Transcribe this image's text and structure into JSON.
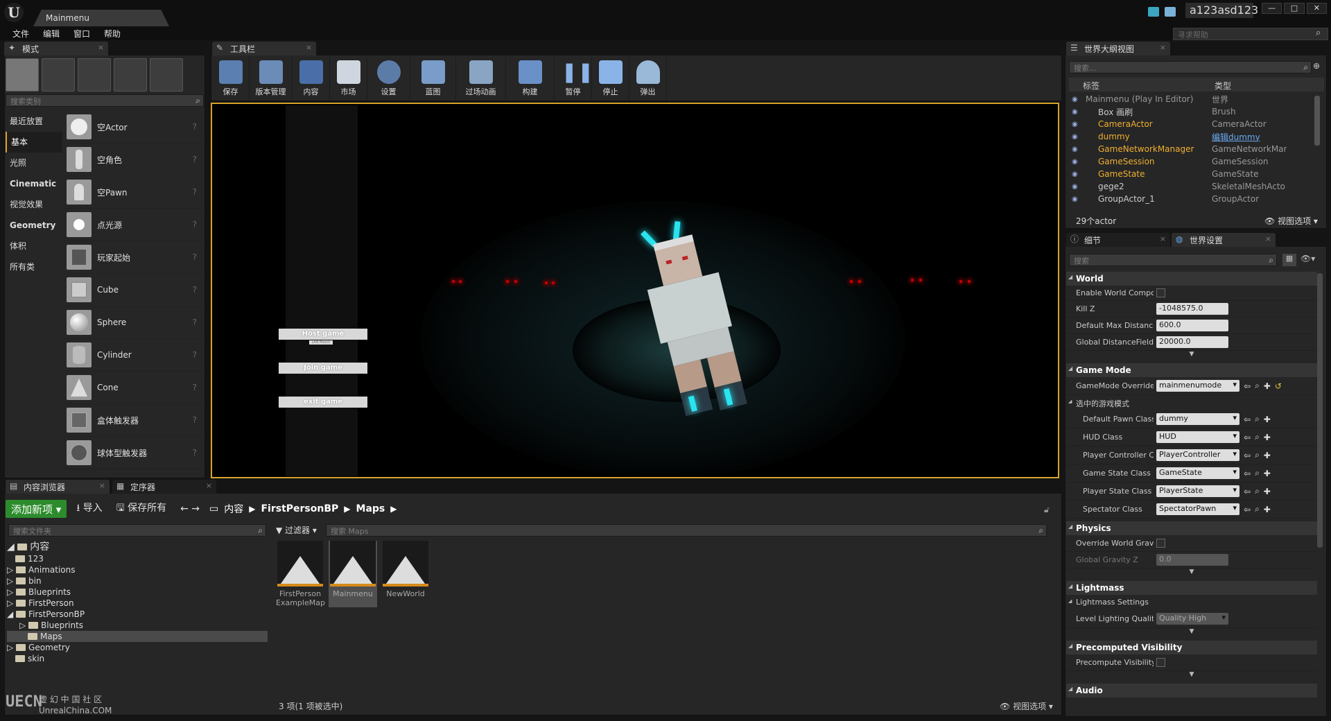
{
  "window": {
    "doc_tab": "Mainmenu",
    "user": "a123asd123",
    "minimize": "—",
    "maximize": "□",
    "close": "✕"
  },
  "menu": [
    "文件",
    "编辑",
    "窗口",
    "帮助"
  ],
  "help_search_placeholder": "寻求帮助",
  "modes": {
    "tab_label": "模式",
    "search_placeholder": "搜索类别",
    "categories": [
      "最近放置",
      "基本",
      "光照",
      "Cinematic",
      "视觉效果",
      "Geometry",
      "体积",
      "所有类"
    ],
    "items": [
      "空Actor",
      "空角色",
      "空Pawn",
      "点光源",
      "玩家起始",
      "Cube",
      "Sphere",
      "Cylinder",
      "Cone",
      "盒体触发器",
      "球体型触发器"
    ]
  },
  "toolbar": {
    "tab_label": "工具栏",
    "buttons": [
      "保存",
      "版本管理",
      "内容",
      "市场",
      "设置",
      "蓝图",
      "过场动画",
      "构建",
      "暂停",
      "停止",
      "弹出"
    ]
  },
  "viewport": {
    "buttons": [
      "Host game",
      "Join game",
      "exit game"
    ],
    "host_sub": "LAN Match"
  },
  "content_browser": {
    "tab_label": "内容浏览器",
    "tab2_label": "定序器",
    "add_new": "添加新项",
    "import": "导入",
    "save_all": "保存所有",
    "breadcrumb": [
      "内容",
      "FirstPersonBP",
      "Maps"
    ],
    "folder_search_placeholder": "搜索文件夹",
    "filter": "过滤器",
    "maps_search_placeholder": "搜索 Maps",
    "tree": [
      {
        "label": "内容",
        "level": 0
      },
      {
        "label": "123",
        "level": 1
      },
      {
        "label": "Animations",
        "level": 1
      },
      {
        "label": "bin",
        "level": 1
      },
      {
        "label": "Blueprints",
        "level": 1
      },
      {
        "label": "FirstPerson",
        "level": 1
      },
      {
        "label": "FirstPersonBP",
        "level": 1
      },
      {
        "label": "Blueprints",
        "level": 2
      },
      {
        "label": "Maps",
        "level": 2
      },
      {
        "label": "Geometry",
        "level": 1
      },
      {
        "label": "skin",
        "level": 1
      }
    ],
    "assets": [
      "FirstPerson ExampleMap",
      "Mainmenu",
      "NewWorld"
    ],
    "count": "3 项(1 项被选中)",
    "view_options": "视图选项",
    "watermark_big": "UECN",
    "watermark_cn": "虚 幻 中 国 社 区",
    "watermark_url": "UnrealChina.COM"
  },
  "outliner": {
    "tab_label": "世界大纲视图",
    "search_placeholder": "搜索...",
    "col_label": "标签",
    "col_type": "类型",
    "rows": [
      {
        "name": "Mainmenu (Play In Editor)",
        "type": "世界"
      },
      {
        "name": "Box 画刷",
        "type": "Brush"
      },
      {
        "name": "CameraActor",
        "type": "CameraActor"
      },
      {
        "name": "dummy",
        "type": "编辑dummy"
      },
      {
        "name": "GameNetworkManager",
        "type": "GameNetworkMar"
      },
      {
        "name": "GameSession",
        "type": "GameSession"
      },
      {
        "name": "GameState",
        "type": "GameState"
      },
      {
        "name": "gege2",
        "type": "SkeletalMeshActo"
      },
      {
        "name": "GroupActor_1",
        "type": "GroupActor"
      }
    ],
    "count": "29个actor",
    "view_options": "视图选项"
  },
  "details": {
    "tab1": "细节",
    "tab2": "世界设置",
    "search_placeholder": "搜索",
    "world": {
      "title": "World",
      "enable_world_compos": "Enable World Compos",
      "kill_z_label": "Kill Z",
      "kill_z": "-1048575.0",
      "max_dist_label": "Default Max Distance",
      "max_dist": "600.0",
      "global_df_label": "Global DistanceField V",
      "global_df": "20000.0"
    },
    "game_mode": {
      "title": "Game Mode",
      "override_label": "GameMode Override",
      "override": "mainmenumode",
      "selected": "选中的游戏模式",
      "rows": [
        {
          "label": "Default Pawn Class",
          "value": "dummy"
        },
        {
          "label": "HUD Class",
          "value": "HUD"
        },
        {
          "label": "Player Controller Cl",
          "value": "PlayerController"
        },
        {
          "label": "Game State Class",
          "value": "GameState"
        },
        {
          "label": "Player State Class",
          "value": "PlayerState"
        },
        {
          "label": "Spectator Class",
          "value": "SpectatorPawn"
        }
      ]
    },
    "physics": {
      "title": "Physics",
      "override_gravity": "Override World Gravit",
      "global_gravity_label": "Global Gravity Z",
      "global_gravity": "0.0"
    },
    "lightmass": {
      "title": "Lightmass",
      "settings": "Lightmass Settings",
      "quality_label": "Level Lighting Quality",
      "quality": "Quality High"
    },
    "precomputed": {
      "title": "Precomputed Visibility",
      "label": "Precompute Visibility"
    },
    "audio": {
      "title": "Audio"
    }
  }
}
